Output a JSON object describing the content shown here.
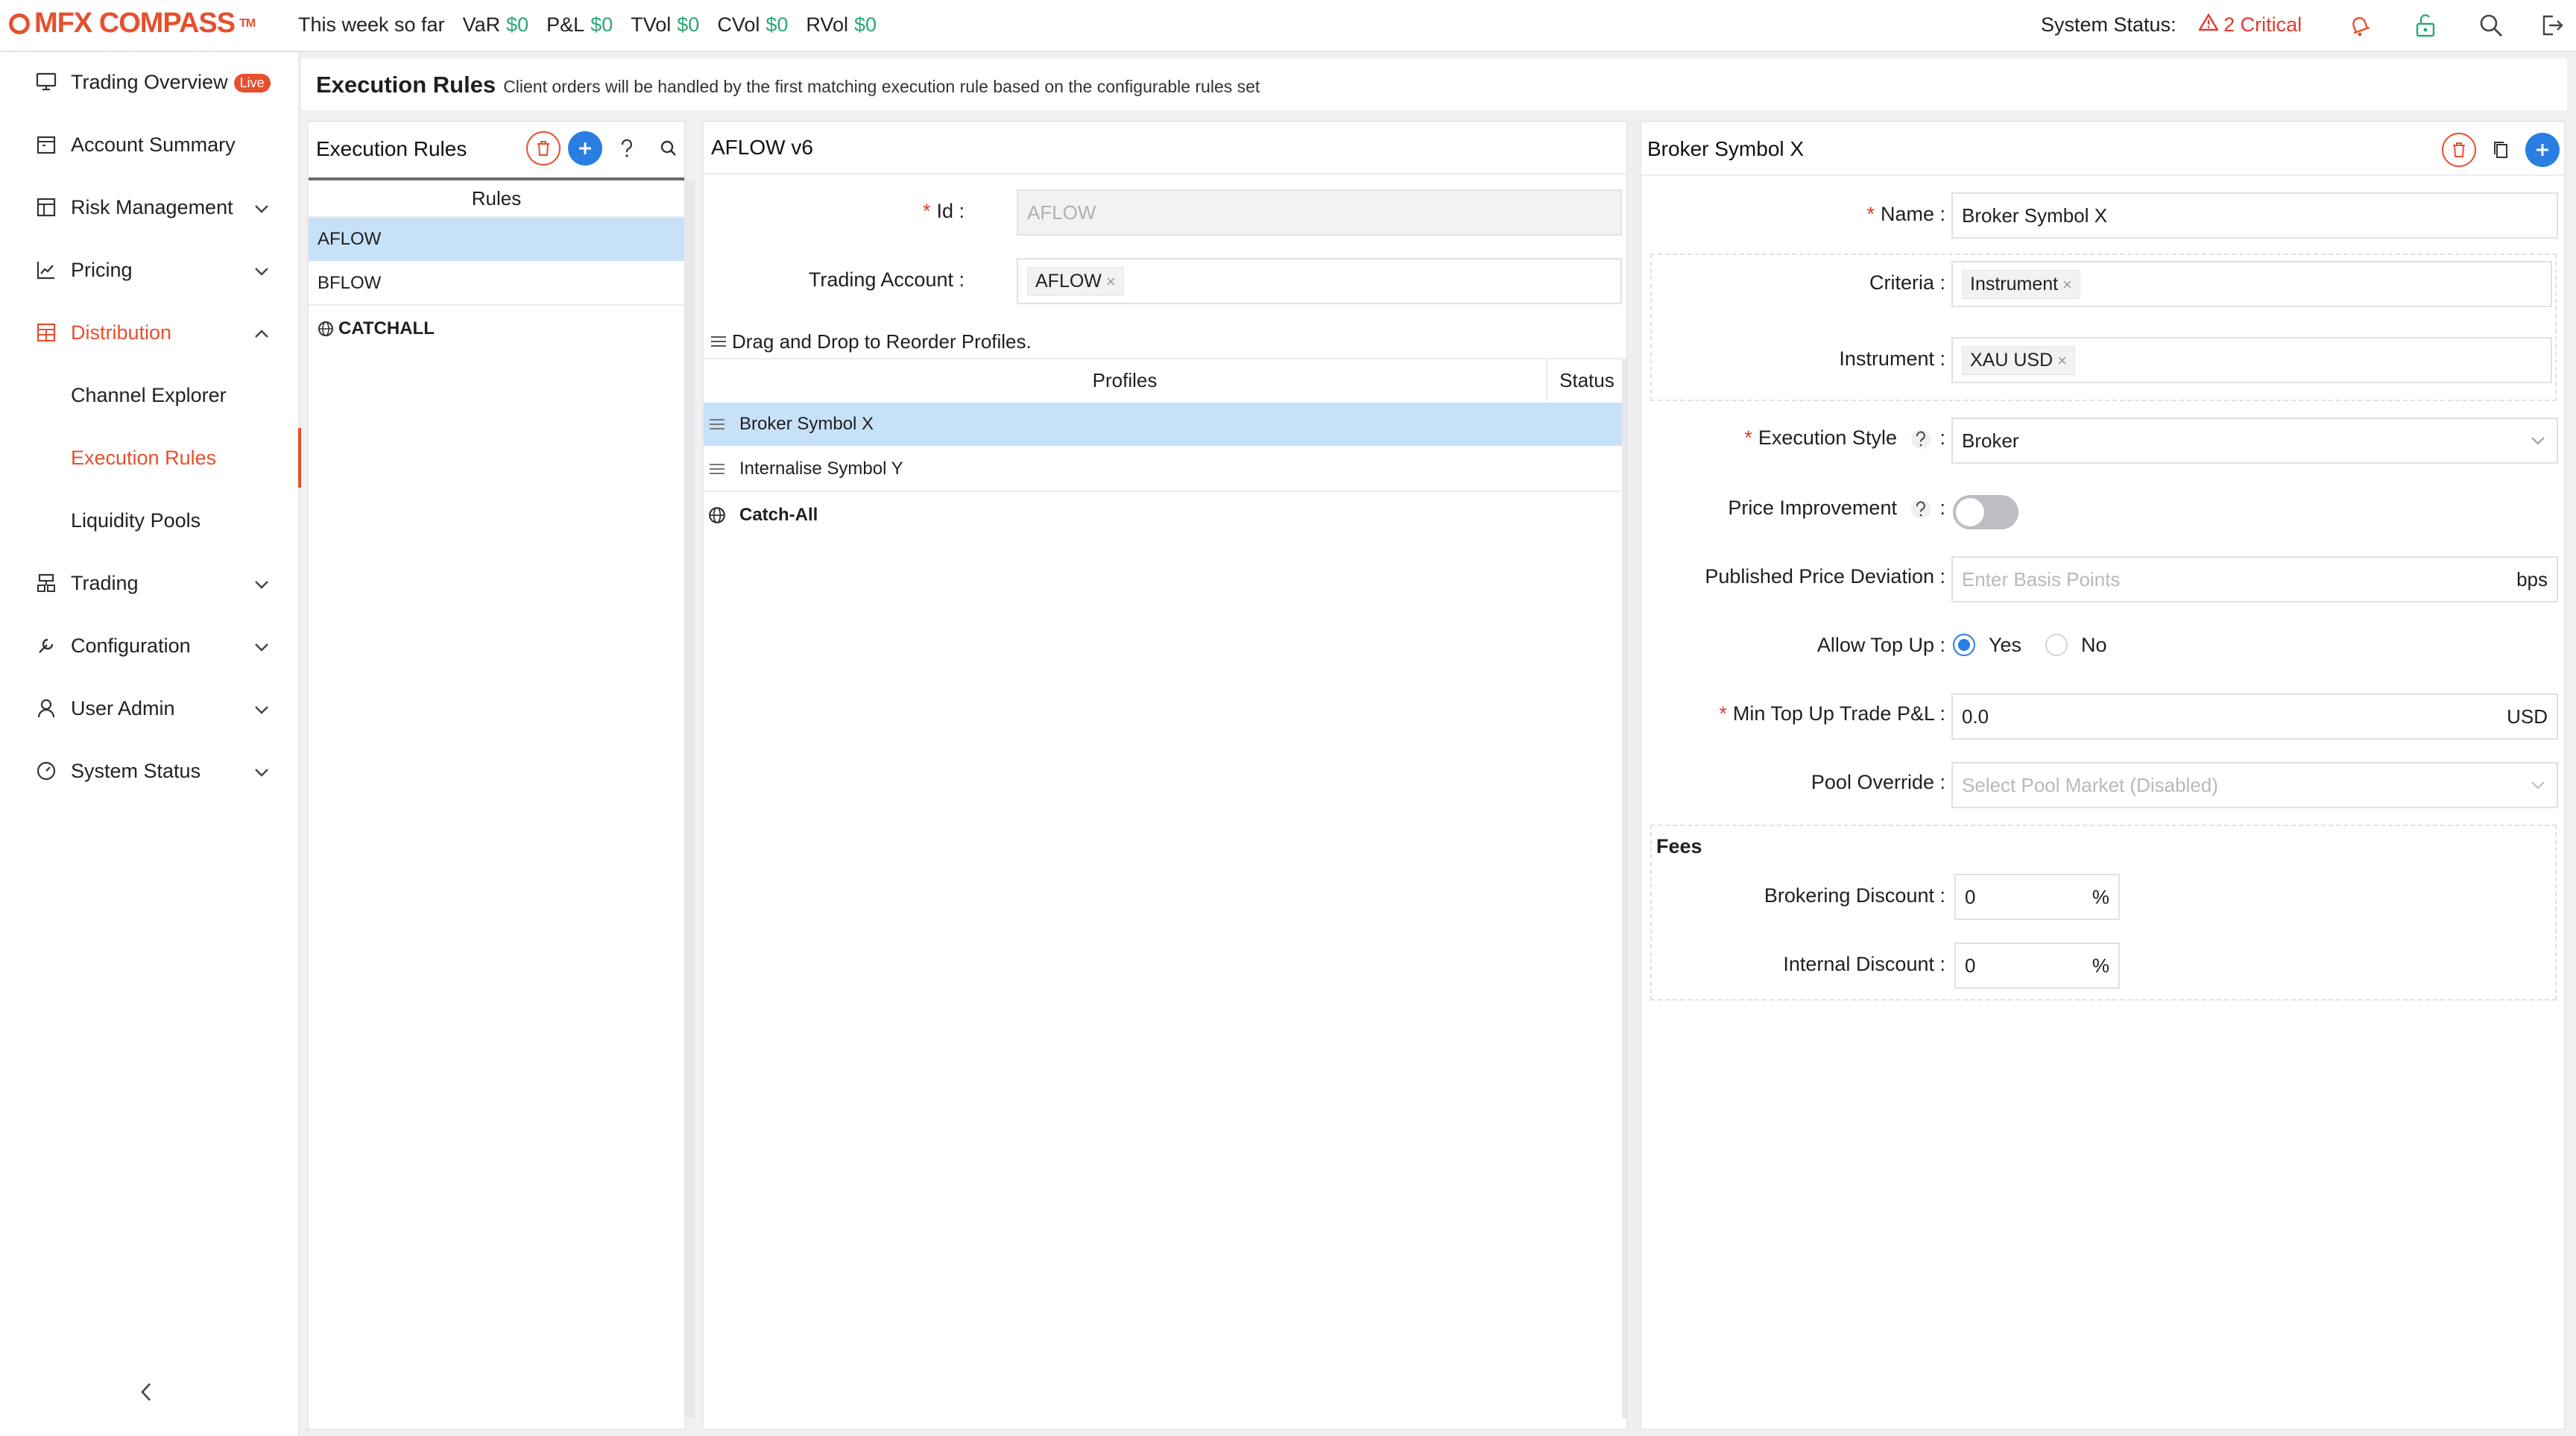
{
  "brand": {
    "logo_text": "MFX COMPASS",
    "tm": "TM",
    "accent": "#e5502f"
  },
  "topbar": {
    "period": "This week so far",
    "metrics": [
      {
        "label": "VaR",
        "value": "$0"
      },
      {
        "label": "P&L",
        "value": "$0"
      },
      {
        "label": "TVol",
        "value": "$0"
      },
      {
        "label": "CVol",
        "value": "$0"
      },
      {
        "label": "RVol",
        "value": "$0"
      }
    ],
    "system_status_label": "System Status:",
    "system_status_value": "2 Critical",
    "icons": [
      "bell-icon",
      "unlock-icon",
      "search-icon",
      "logout-icon"
    ]
  },
  "sidebar": {
    "items": [
      {
        "label": "Trading Overview",
        "badge": "Live",
        "icon": "monitor-icon"
      },
      {
        "label": "Account Summary",
        "icon": "calendar-icon"
      },
      {
        "label": "Risk Management",
        "icon": "risk-icon"
      },
      {
        "label": "Pricing",
        "icon": "chart-line-icon"
      },
      {
        "label": "Distribution",
        "icon": "distribution-icon"
      },
      {
        "label": "Channel Explorer"
      },
      {
        "label": "Execution Rules"
      },
      {
        "label": "Liquidity Pools"
      },
      {
        "label": "Trading",
        "icon": "trading-icon"
      },
      {
        "label": "Configuration",
        "icon": "wrench-icon"
      },
      {
        "label": "User Admin",
        "icon": "user-icon"
      },
      {
        "label": "System Status",
        "icon": "dashboard-icon"
      }
    ],
    "collapse_icon": "chevron-left-icon"
  },
  "page": {
    "title": "Execution Rules",
    "subtitle": "Client orders will be handled by the first matching execution rule based on the configurable rules set"
  },
  "rules_panel": {
    "title": "Execution Rules",
    "column": "Rules",
    "rows": [
      "AFLOW",
      "BFLOW",
      "CATCHALL"
    ]
  },
  "detail_panel": {
    "title": "AFLOW v6",
    "id_label": "Id",
    "id_value": "AFLOW",
    "account_label": "Trading Account",
    "account_tag": "AFLOW",
    "drag_hint": "Drag and Drop to Reorder Profiles.",
    "col_profiles": "Profiles",
    "col_status": "Status",
    "profiles": [
      "Broker Symbol X",
      "Internalise Symbol Y",
      "Catch-All"
    ]
  },
  "profile_panel": {
    "title": "Broker Symbol X",
    "name_label": "Name",
    "name_value": "Broker Symbol X",
    "criteria_label": "Criteria",
    "criteria_tag": "Instrument",
    "instrument_label": "Instrument",
    "instrument_tag": "XAU USD",
    "exec_style_label": "Execution Style",
    "exec_style_value": "Broker",
    "price_improvement_label": "Price Improvement",
    "price_improvement_on": false,
    "ppd_label": "Published Price Deviation",
    "ppd_placeholder": "Enter Basis Points",
    "ppd_unit": "bps",
    "topup_label": "Allow Top Up",
    "topup_yes": "Yes",
    "topup_no": "No",
    "topup_selected": "Yes",
    "min_topup_label": "Min Top Up Trade P&L",
    "min_topup_value": "0.0",
    "min_topup_unit": "USD",
    "pool_label": "Pool Override",
    "pool_placeholder": "Select Pool Market (Disabled)",
    "fees_title": "Fees",
    "brokering_label": "Brokering Discount",
    "brokering_value": "0",
    "internal_label": "Internal Discount",
    "internal_value": "0",
    "percent": "%"
  },
  "colors": {
    "select_bg": "#c7e1f8",
    "positive": "#2aa872",
    "critical": "#e03a2d",
    "primary": "#2a7de1"
  }
}
